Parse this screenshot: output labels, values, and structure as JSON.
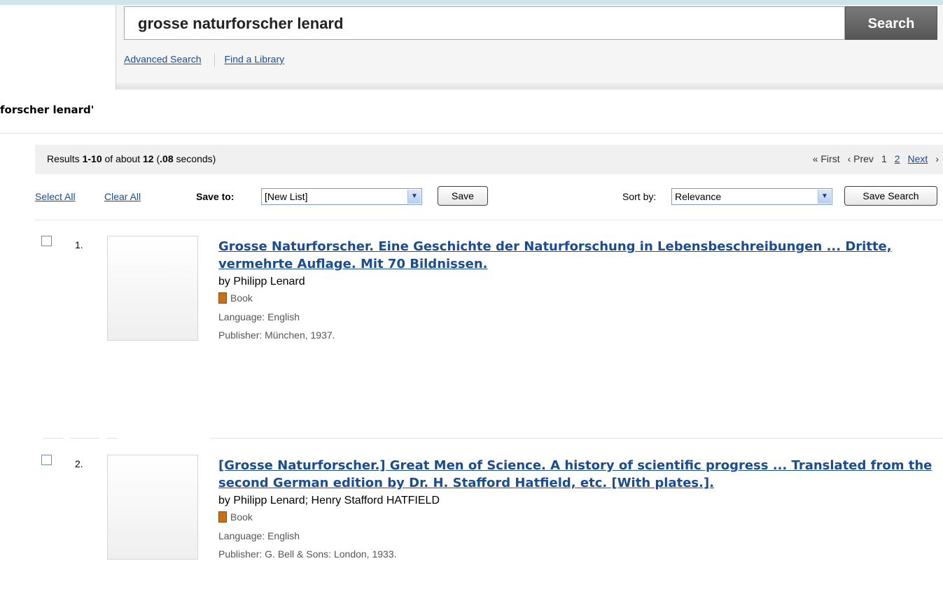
{
  "search": {
    "query": "grosse naturforscher lenard",
    "button": "Search",
    "links": [
      "Advanced Search",
      "Find a Library"
    ]
  },
  "heading": "forscher lenard'",
  "results_info": {
    "prefix": "Results ",
    "range": "1-10",
    "mid": " of about ",
    "total": "12",
    "open": " (",
    "time": ".08",
    "suffix": " seconds)"
  },
  "pager": {
    "first": "« First",
    "prev": "‹ Prev",
    "page1": "1",
    "page2": "2",
    "next": "Next",
    "next_arrow": "›"
  },
  "tools": {
    "select_all": "Select All",
    "clear_all": "Clear All",
    "save_to_label": "Save to:",
    "list_value": "[New List]",
    "save": "Save",
    "sort_label": "Sort by:",
    "sort_value": "Relevance",
    "save_search": "Save Search"
  },
  "results": [
    {
      "num": "1.",
      "title": "Grosse Naturforscher. Eine Geschichte der Naturforschung in Lebensbeschreibungen ... Dritte, vermehrte Auflage. Mit 70 Bildnissen.",
      "author": "by Philipp Lenard",
      "format": "Book",
      "language": "Language: English",
      "publisher": "Publisher: München, 1937."
    },
    {
      "num": "2.",
      "title": "[Grosse Naturforscher.] Great Men of Science. A history of scientific progress ... Translated from the second German edition by Dr. H. Stafford Hatfield, etc. [With plates.].",
      "author": "by Philipp Lenard; Henry Stafford HATFIELD",
      "format": "Book",
      "language": "Language: English",
      "publisher": "Publisher: G. Bell & Sons: London, 1933."
    }
  ],
  "icons": {
    "format": "book-icon",
    "dropdown": "chevron-down-icon"
  }
}
